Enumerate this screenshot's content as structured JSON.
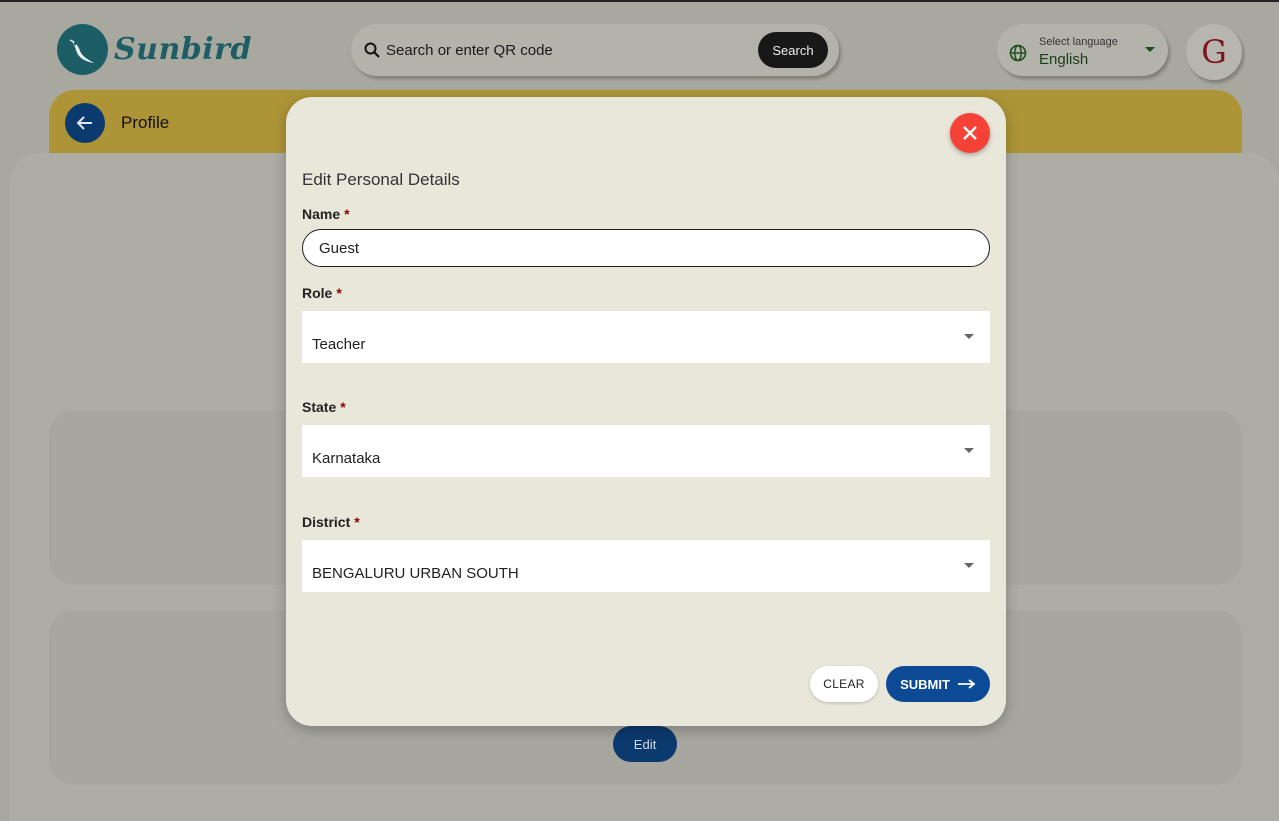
{
  "header": {
    "logo_text": "Sunbird",
    "search": {
      "placeholder": "Search or enter QR code",
      "button_label": "Search"
    },
    "language": {
      "label": "Select language",
      "value": "English"
    },
    "avatar_initial": "G"
  },
  "profile_bar": {
    "title": "Profile"
  },
  "background": {
    "edit_label": "Edit"
  },
  "modal": {
    "title": "Edit Personal Details",
    "name": {
      "label": "Name",
      "required_mark": "*",
      "value": "Guest"
    },
    "role": {
      "label": "Role",
      "required_mark": "*",
      "value": "Teacher"
    },
    "state": {
      "label": "State",
      "required_mark": "*",
      "value": "Karnataka"
    },
    "district": {
      "label": "District",
      "required_mark": "*",
      "value": "BENGALURU URBAN SOUTH"
    },
    "clear_label": "CLEAR",
    "submit_label": "SUBMIT"
  },
  "colors": {
    "brand_teal": "#1d5d66",
    "primary_blue": "#0d4a96",
    "close_red": "#f44336",
    "required_red": "#8b0000"
  },
  "icons": [
    "sunbird-logo-icon",
    "search-icon",
    "globe-icon",
    "chevron-down-icon",
    "back-arrow-icon",
    "close-icon",
    "arrow-right-icon"
  ]
}
